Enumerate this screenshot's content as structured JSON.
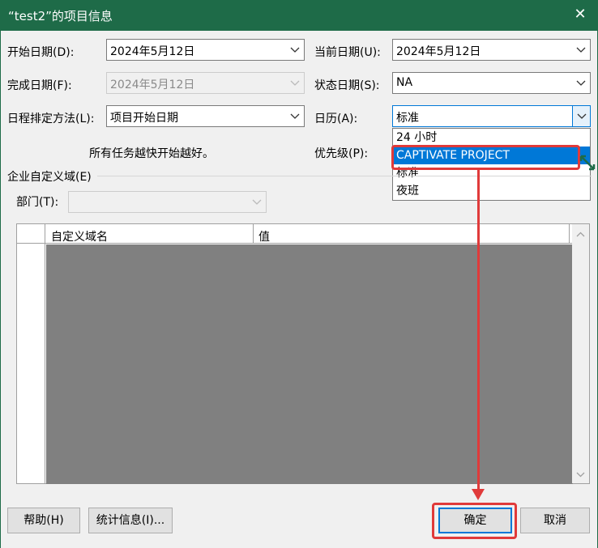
{
  "window": {
    "title": "“test2”的项目信息",
    "close_glyph": "✕"
  },
  "fields": {
    "start_date_label": "开始日期(D):",
    "start_date_value": "2024年5月12日",
    "current_date_label": "当前日期(U):",
    "current_date_value": "2024年5月12日",
    "finish_date_label": "完成日期(F):",
    "finish_date_value": "2024年5月12日",
    "status_date_label": "状态日期(S):",
    "status_date_value": "NA",
    "schedule_method_label": "日程排定方法(L):",
    "schedule_method_value": "项目开始日期",
    "calendar_label": "日历(A):",
    "calendar_value": "标准",
    "schedule_hint": "所有任务越快开始越好。",
    "priority_label": "优先级(P):"
  },
  "calendar_dropdown": {
    "options": [
      "24 小时",
      "CAPTIVATE PROJECT",
      "标准",
      "夜班"
    ],
    "selected_index": 1
  },
  "custom_fields": {
    "group_label": "企业自定义域(E)",
    "department_label": "部门(T):",
    "department_value": "",
    "columns": [
      "自定义域名",
      "值"
    ]
  },
  "buttons": {
    "help": "帮助(H)",
    "statistics": "统计信息(I)...",
    "ok": "确定",
    "cancel": "取消"
  },
  "colors": {
    "titlebar": "#1e6b48",
    "annotation": "#e03a3a",
    "selection": "#0078d7"
  }
}
